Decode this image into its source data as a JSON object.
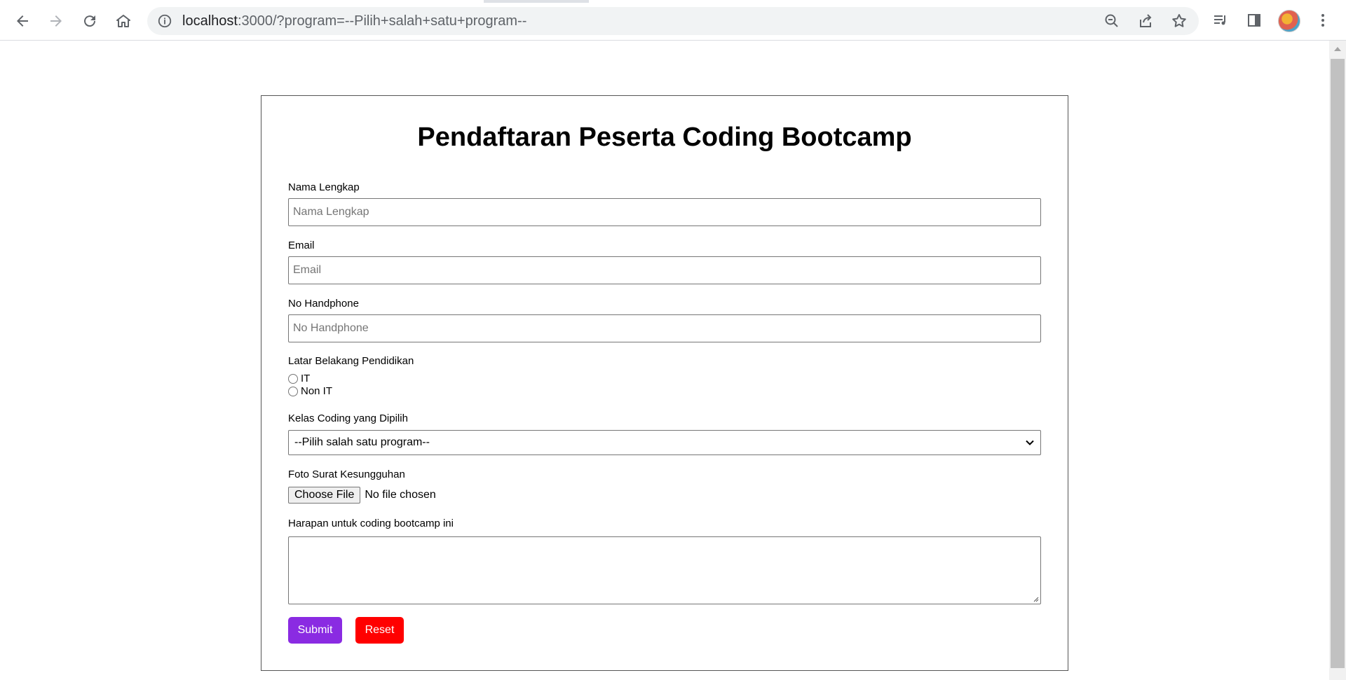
{
  "browser": {
    "url_host": "localhost",
    "url_rest": ":3000/?program=--Pilih+salah+satu+program--",
    "icons": [
      "back-icon",
      "forward-icon",
      "reload-icon",
      "home-icon",
      "site-info-icon",
      "zoom-out-icon",
      "share-icon",
      "bookmark-star-icon",
      "media-queue-icon",
      "side-panel-icon",
      "profile-avatar",
      "more-menu-icon"
    ]
  },
  "form": {
    "title": "Pendaftaran Peserta Coding Bootcamp",
    "name": {
      "label": "Nama Lengkap",
      "placeholder": "Nama Lengkap"
    },
    "email": {
      "label": "Email",
      "placeholder": "Email"
    },
    "phone": {
      "label": "No Handphone",
      "placeholder": "No Handphone"
    },
    "education": {
      "label": "Latar Belakang Pendidikan",
      "options": [
        "IT",
        "Non IT"
      ]
    },
    "program": {
      "label": "Kelas Coding yang Dipilih",
      "selected": "--Pilih salah satu program--"
    },
    "file": {
      "label": "Foto Surat Kesungguhan",
      "button": "Choose File",
      "status": "No file chosen"
    },
    "hope": {
      "label": "Harapan untuk coding bootcamp ini"
    },
    "submit": "Submit",
    "reset": "Reset"
  },
  "colors": {
    "submit": "#8a2be2",
    "reset": "#ff0000"
  }
}
